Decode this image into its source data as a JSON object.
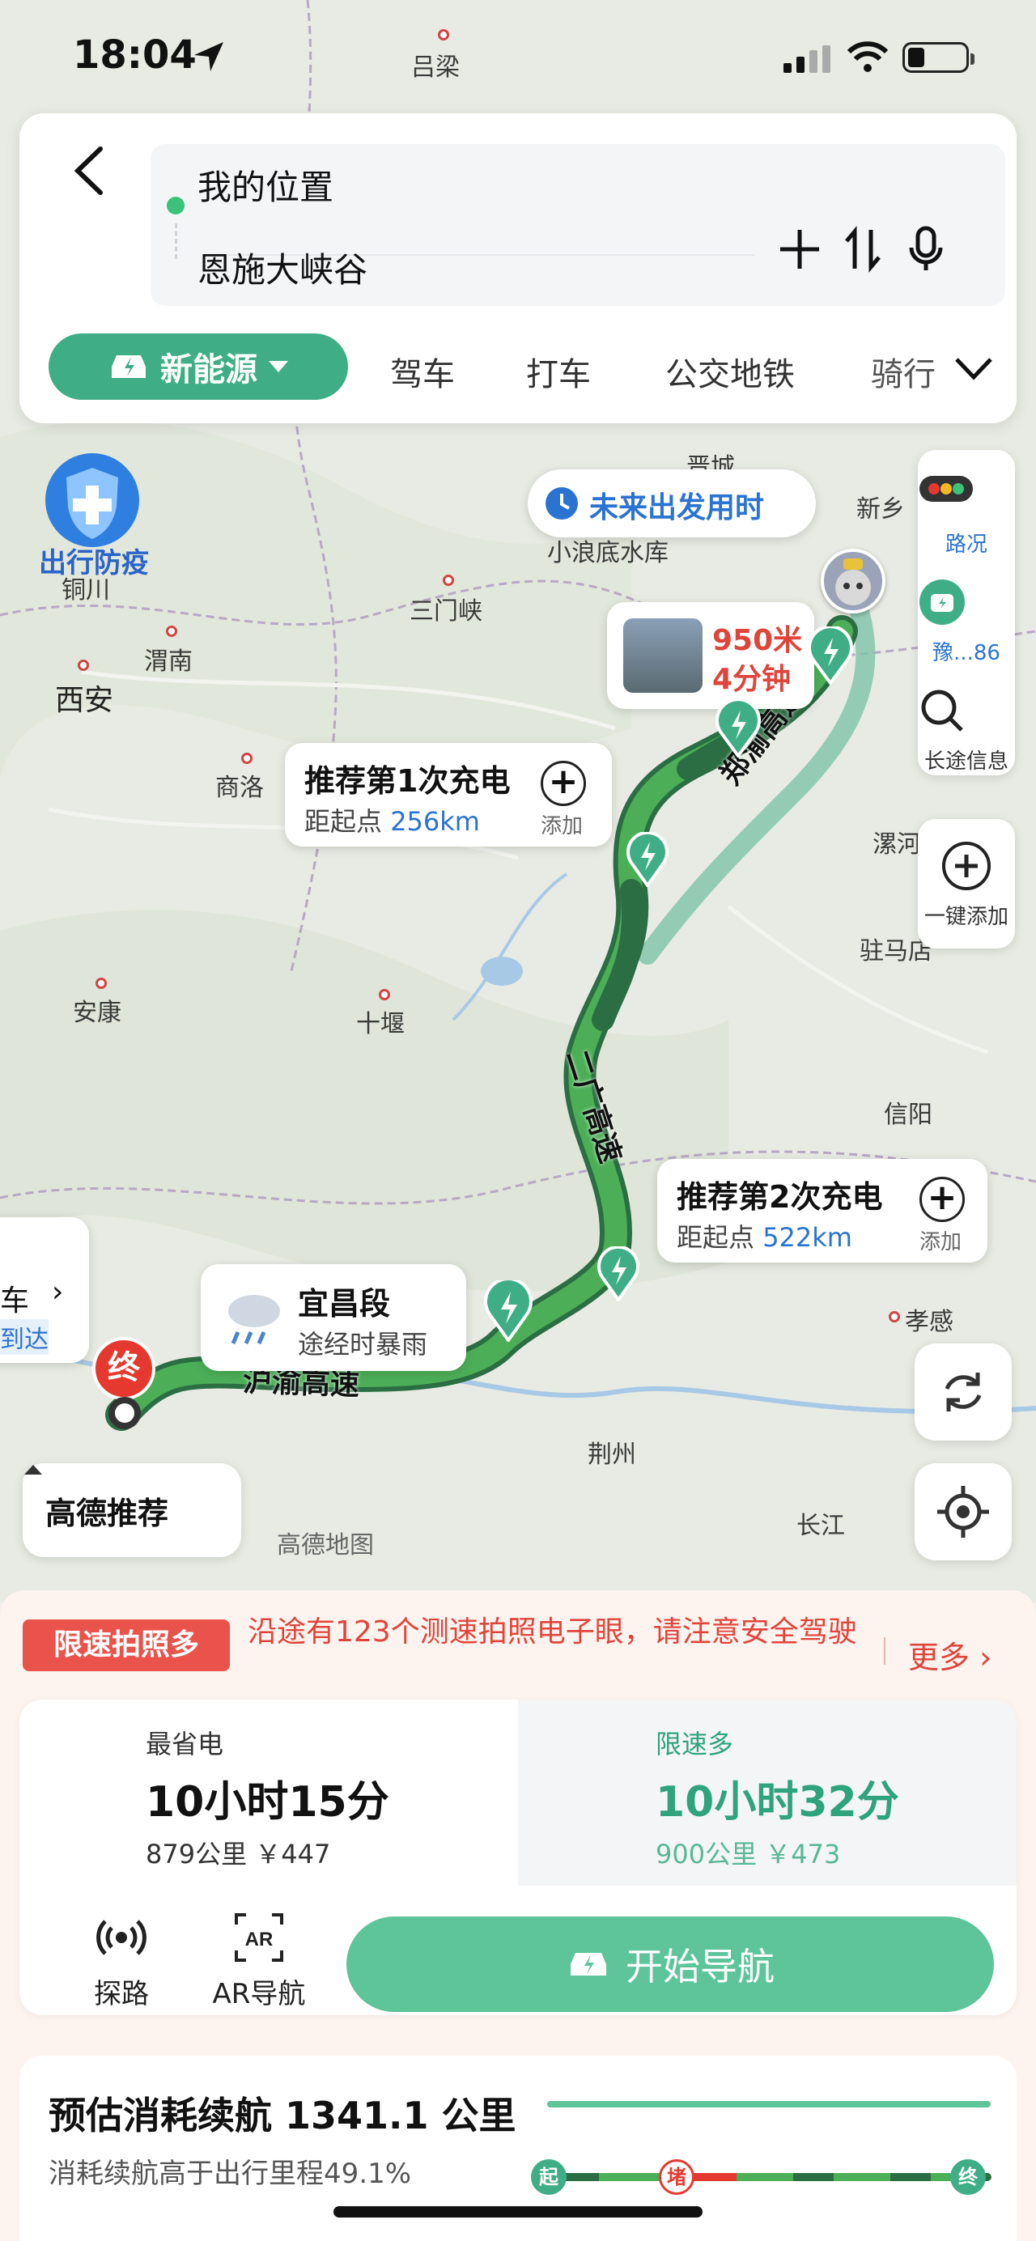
{
  "status_bar": {
    "time": "18:04"
  },
  "search": {
    "origin": "我的位置",
    "destination": "恩施大峡谷"
  },
  "tabs": {
    "active": "新能源",
    "items": [
      "驾车",
      "打车",
      "公交地铁",
      "骑行"
    ]
  },
  "map": {
    "cities": {
      "lvliang": "吕梁",
      "tongchuan": "铜川",
      "weinan": "渭南",
      "xian": "西安",
      "sanmenxia": "三门峡",
      "xiaolangdi": "小浪底水库",
      "jincheng": "晋城",
      "xinxiang": "新乡",
      "shangluo": "商洛",
      "luohe": "漯河",
      "zhumadian": "驻马店",
      "ankang": "安康",
      "shiyan": "十堰",
      "xinyang": "信阳",
      "xiaogan": "孝感",
      "jingzhou": "荆州",
      "changjiang": "长江"
    },
    "roads": {
      "zhengyu": "郑渝高速",
      "erguang": "二广高速",
      "huyu": "沪渝高速"
    },
    "epidemic_label": "出行防疫",
    "future_departure": "未来出发用时",
    "traffic_popup": {
      "distance": "950米",
      "time": "4分钟"
    },
    "charge1": {
      "title": "推荐第1次充电",
      "prefix": "距起点",
      "distance": "256km",
      "add": "添加"
    },
    "charge2": {
      "title": "推荐第2次充电",
      "prefix": "距起点",
      "distance": "522km",
      "add": "添加"
    },
    "weather": {
      "title": "宜昌段",
      "desc": "途经时暴雨"
    },
    "end_pin": "终",
    "side_text_top": "车",
    "side_text_bottom": "到达",
    "recommend": "高德推荐",
    "watermark": "高德地图"
  },
  "right_controls": {
    "traffic": "路况",
    "plate": "豫...86",
    "long_trip": "长途信息",
    "one_key_add": "一键添加"
  },
  "notice": {
    "badge": "限速拍照多",
    "text": "沿途有123个测速拍照电子眼，请注意安全驾驶",
    "more": "更多"
  },
  "routes": [
    {
      "tag": "最省电",
      "time": "10小时15分",
      "info": "879公里 ￥447"
    },
    {
      "tag": "限速多",
      "time": "10小时32分",
      "info": "900公里 ￥473"
    }
  ],
  "actions": {
    "probe": "探路",
    "ar": "AR导航",
    "start": "开始导航"
  },
  "estimate": {
    "title": "预估消耗续航 1341.1 公里",
    "sub": "消耗续航高于出行里程49.1%",
    "start": "起",
    "jam": "堵",
    "end": "终"
  },
  "colors": {
    "accent": "#3fae87",
    "route": "#3d9a5a",
    "alert": "#e9534c"
  }
}
